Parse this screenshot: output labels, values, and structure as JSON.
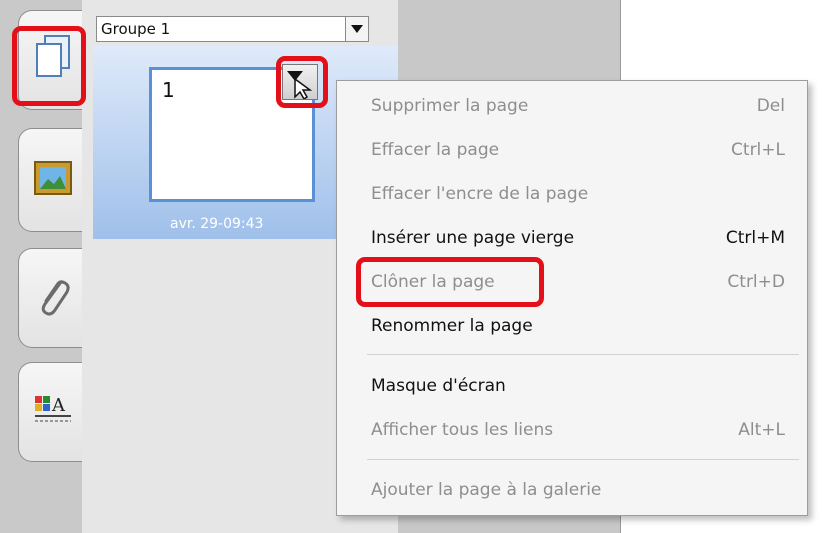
{
  "sorter": {
    "group_name": "Groupe 1",
    "page_thumb": {
      "number": "1",
      "date": "avr. 29-09:43"
    }
  },
  "side_tabs": [
    {
      "icon": "page-sorter-icon"
    },
    {
      "icon": "gallery-icon"
    },
    {
      "icon": "attachments-icon"
    },
    {
      "icon": "properties-icon"
    }
  ],
  "context_menu": {
    "items": [
      {
        "label": "Supprimer la page",
        "shortcut": "Del",
        "enabled": false
      },
      {
        "label": "Effacer la page",
        "shortcut": "Ctrl+L",
        "enabled": false
      },
      {
        "label": "Effacer l'encre de la page",
        "shortcut": "",
        "enabled": false
      },
      {
        "label": "Insérer une page vierge",
        "shortcut": "Ctrl+M",
        "enabled": true
      },
      {
        "label": "Clôner la page",
        "shortcut": "Ctrl+D",
        "enabled": false
      },
      {
        "label": "Renommer la page",
        "shortcut": "",
        "enabled": true
      },
      {
        "label": "Masque d'écran",
        "shortcut": "",
        "enabled": true
      },
      {
        "label": "Afficher tous les liens",
        "shortcut": "Alt+L",
        "enabled": false
      },
      {
        "label": "Ajouter la page à la galerie",
        "shortcut": "",
        "enabled": false
      }
    ]
  },
  "colors": {
    "highlight": "#e3101a",
    "selection": "#5b8fd6"
  }
}
